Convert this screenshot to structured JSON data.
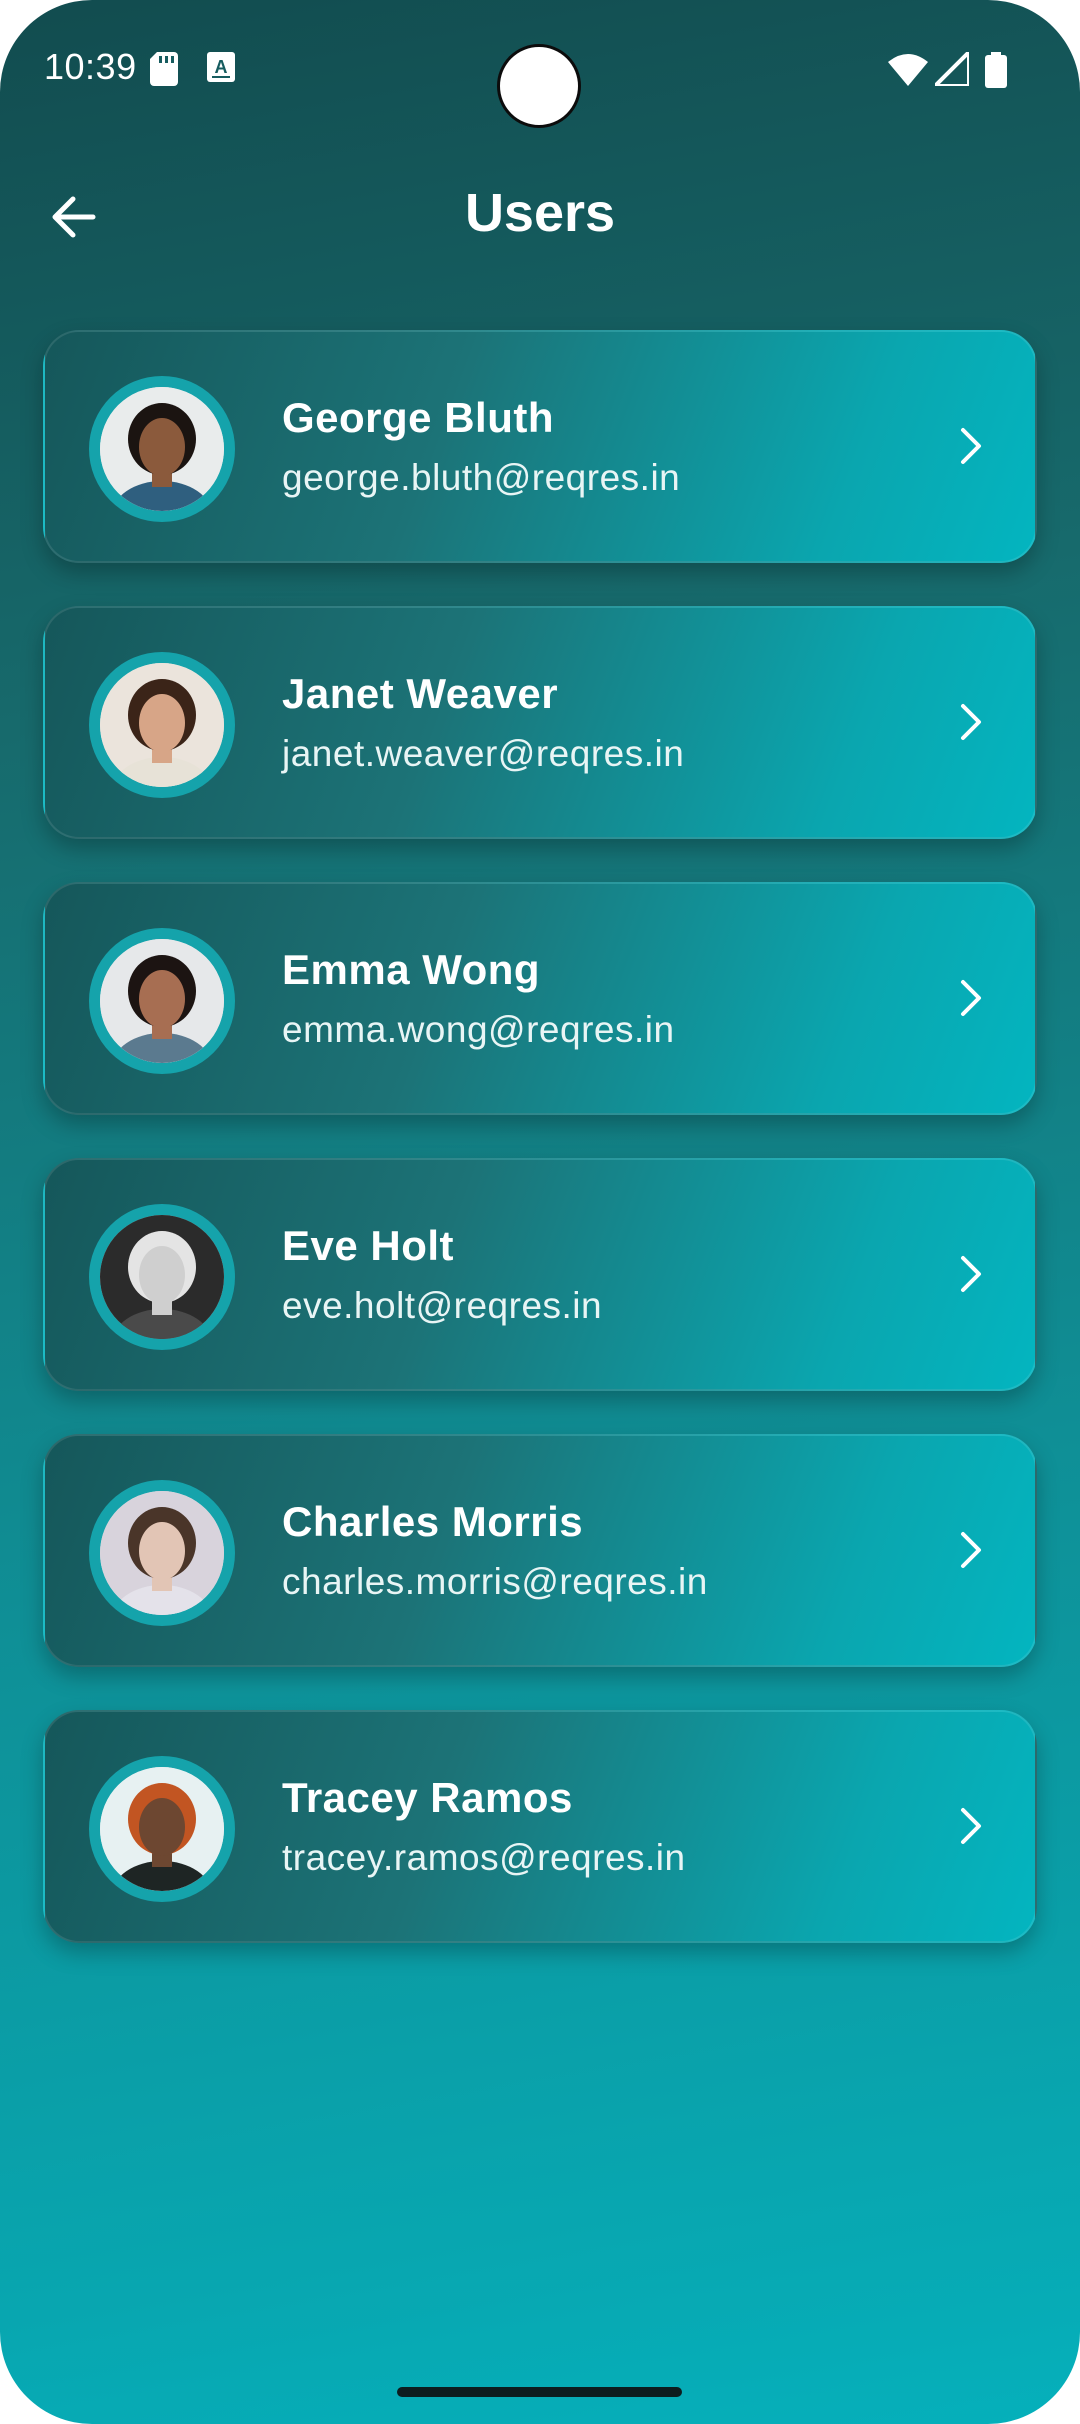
{
  "status_bar": {
    "time": "10:39",
    "icons": [
      "sd-card-icon",
      "a-keyboard-icon",
      "wifi-icon",
      "signal-icon",
      "battery-icon"
    ]
  },
  "header": {
    "title": "Users",
    "back_icon": "arrow-left-icon"
  },
  "users": [
    {
      "name": "George Bluth",
      "email": "george.bluth@reqres.in",
      "avatar_bg": "#e9ecec",
      "skin": "#8b5a3c",
      "hair": "#1b1411",
      "shirt": "#2f5f7f"
    },
    {
      "name": "Janet Weaver",
      "email": "janet.weaver@reqres.in",
      "avatar_bg": "#ebe4dc",
      "skin": "#d7a587",
      "hair": "#3b2418",
      "shirt": "#e7e2d7"
    },
    {
      "name": "Emma Wong",
      "email": "emma.wong@reqres.in",
      "avatar_bg": "#e6e8ea",
      "skin": "#a76e52",
      "hair": "#1c1412",
      "shirt": "#5b7a8f"
    },
    {
      "name": "Eve Holt",
      "email": "eve.holt@reqres.in",
      "avatar_bg": "#2b2b2b",
      "skin": "#cfcfcf",
      "hair": "#e4e4e4",
      "shirt": "#4a4a4a"
    },
    {
      "name": "Charles Morris",
      "email": "charles.morris@reqres.in",
      "avatar_bg": "#d8d3dc",
      "skin": "#e2c5b5",
      "hair": "#4a3529",
      "shirt": "#e4e2ea"
    },
    {
      "name": "Tracey Ramos",
      "email": "tracey.ramos@reqres.in",
      "avatar_bg": "#e7f1f2",
      "skin": "#6d4731",
      "hair": "#c25522",
      "shirt": "#1e2524"
    }
  ],
  "colors": {
    "background_top": "#124c4f",
    "background_bottom": "#05b0bb",
    "card_start": "#15575a",
    "card_end": "#03b5c0",
    "avatar_ring": "#15a3ab"
  }
}
